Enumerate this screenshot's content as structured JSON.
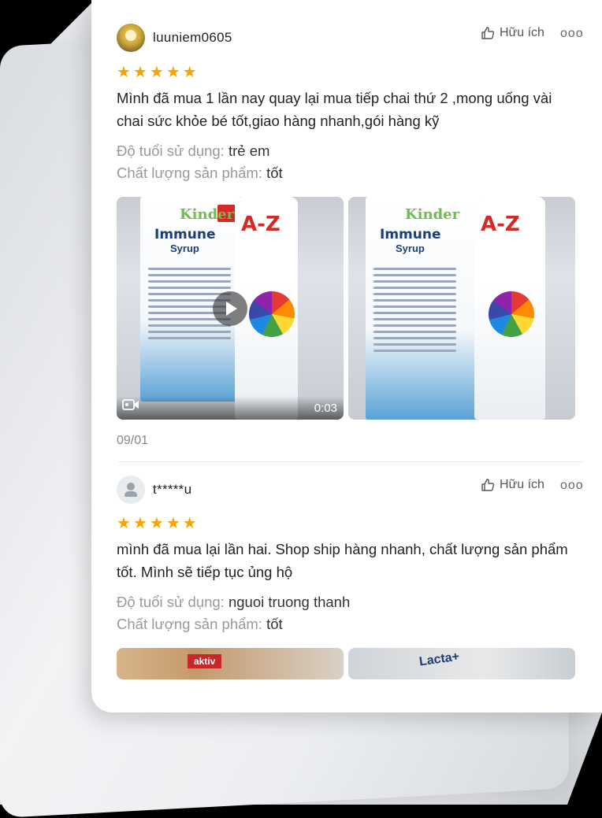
{
  "reviews": [
    {
      "username": "luuniem0605",
      "helpful_label": "Hữu ích",
      "more_label": "ooo",
      "rating": 5,
      "content": "Mình đã mua 1 lần nay quay lại mua tiếp chai thứ 2 ,mong uống vài chai sức khỏe bé tốt,giao hàng nhanh,gói hàng kỹ",
      "attributes": [
        {
          "label": "Độ tuổi sử dụng: ",
          "value": "trẻ em"
        },
        {
          "label": "Chất lượng sản phẩm: ",
          "value": "tốt"
        }
      ],
      "video_duration": "0:03",
      "date": "09/01"
    },
    {
      "username": "t*****u",
      "helpful_label": "Hữu ích",
      "more_label": "ooo",
      "rating": 5,
      "content": "mình đã mua lại lần hai. Shop ship hàng nhanh, chất lượng sản phẩm tốt. Mình sẽ tiếp tục ủng hộ",
      "attributes": [
        {
          "label": "Độ tuổi sử dụng: ",
          "value": "nguoi truong thanh"
        },
        {
          "label": "Chất lượng sản phẩm: ",
          "value": "tốt"
        }
      ]
    }
  ],
  "product_text": {
    "kinder": "Kinder",
    "immune": "Immune",
    "syrup": "Syrup",
    "az": "A-Z",
    "aktiv": "aktiv",
    "lacta": "Lacta+"
  },
  "colors": {
    "star": "#f7a400",
    "text": "#222222",
    "muted": "#999999"
  },
  "icons": [
    "thumbs-up-icon",
    "more-icon",
    "star-icon",
    "play-icon",
    "video-camera-icon",
    "user-icon"
  ]
}
